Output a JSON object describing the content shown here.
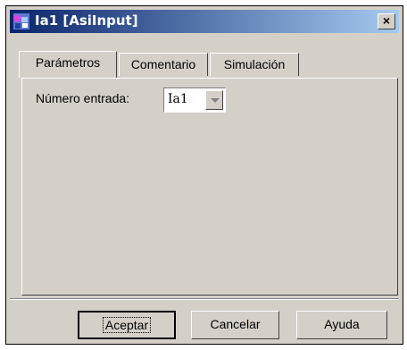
{
  "window": {
    "title": "Ia1 [AsiInput]",
    "close_label": "×"
  },
  "tabs": [
    {
      "label": "Parámetros",
      "active": true
    },
    {
      "label": "Comentario",
      "active": false
    },
    {
      "label": "Simulación",
      "active": false
    }
  ],
  "form": {
    "entrada_label": "Número entrada:",
    "entrada_value": "Ia1"
  },
  "buttons": {
    "accept": "Aceptar",
    "cancel": "Cancelar",
    "help": "Ayuda"
  },
  "colors": {
    "titlebar_start": "#0a246a",
    "titlebar_end": "#a6caf0",
    "face": "#d4d0c8"
  }
}
